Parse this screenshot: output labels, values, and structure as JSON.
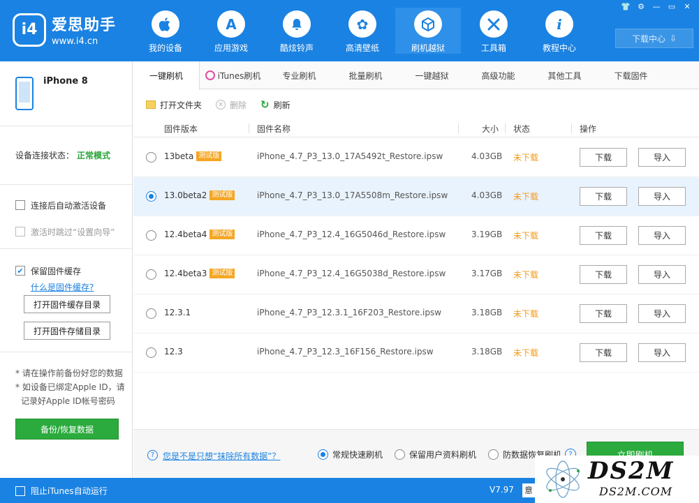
{
  "app": {
    "name": "爱思助手",
    "url": "www.i4.cn",
    "logo_mark": "i4"
  },
  "nav": [
    {
      "label": "我的设备",
      "icon": "apple-icon",
      "glyph": ""
    },
    {
      "label": "应用游戏",
      "icon": "app-store-icon",
      "glyph": "A"
    },
    {
      "label": "酷炫铃声",
      "icon": "bell-icon",
      "glyph": "🔔"
    },
    {
      "label": "高清壁纸",
      "icon": "flower-icon",
      "glyph": "✿"
    },
    {
      "label": "刷机越狱",
      "icon": "box-icon",
      "glyph": "⬡"
    },
    {
      "label": "工具箱",
      "icon": "tools-icon",
      "glyph": "✂"
    },
    {
      "label": "教程中心",
      "icon": "info-icon",
      "glyph": "i"
    }
  ],
  "window_controls": [
    "👕",
    "⚙",
    "—",
    "▭",
    "✕"
  ],
  "download_center": "下载中心",
  "left": {
    "device_name": "iPhone 8",
    "conn_label": "设备连接状态：",
    "conn_mode": "正常模式",
    "opt1": "连接后自动激活设备",
    "opt2": "激活时跳过“设置向导”",
    "cache_label": "保留固件缓存",
    "cache_link": "什么是固件缓存?",
    "btn_cache_dir": "打开固件缓存目录",
    "btn_store_dir": "打开固件存储目录",
    "note1": "* 请在操作前备份好您的数据",
    "note2": "* 如设备已绑定Apple ID，请",
    "note3": "记录好Apple ID帐号密码",
    "backup_btn": "备份/恢复数据"
  },
  "tabs": [
    "一键刷机",
    "iTunes刷机",
    "专业刷机",
    "批量刷机",
    "一键越狱",
    "高级功能",
    "其他工具",
    "下载固件"
  ],
  "toolbar": {
    "open_folder": "打开文件夹",
    "delete": "删除",
    "refresh": "刷新"
  },
  "table": {
    "headers": {
      "version": "固件版本",
      "name": "固件名称",
      "size": "大小",
      "status": "状态",
      "action": "操作"
    },
    "btn_download": "下载",
    "btn_import": "导入",
    "beta_badge": "测试版",
    "rows": [
      {
        "version": "13beta",
        "beta": true,
        "name": "iPhone_4.7_P3_13.0_17A5492t_Restore.ipsw",
        "size": "4.03GB",
        "status": "未下载",
        "selected": false
      },
      {
        "version": "13.0beta2",
        "beta": true,
        "name": "iPhone_4.7_P3_13.0_17A5508m_Restore.ipsw",
        "size": "4.03GB",
        "status": "未下载",
        "selected": true
      },
      {
        "version": "12.4beta4",
        "beta": true,
        "name": "iPhone_4.7_P3_12.4_16G5046d_Restore.ipsw",
        "size": "3.19GB",
        "status": "未下载",
        "selected": false
      },
      {
        "version": "12.4beta3",
        "beta": true,
        "name": "iPhone_4.7_P3_12.4_16G5038d_Restore.ipsw",
        "size": "3.17GB",
        "status": "未下载",
        "selected": false
      },
      {
        "version": "12.3.1",
        "beta": false,
        "name": "iPhone_4.7_P3_12.3.1_16F203_Restore.ipsw",
        "size": "3.18GB",
        "status": "未下载",
        "selected": false
      },
      {
        "version": "12.3",
        "beta": false,
        "name": "iPhone_4.7_P3_12.3_16F156_Restore.ipsw",
        "size": "3.18GB",
        "status": "未下载",
        "selected": false
      }
    ]
  },
  "footer": {
    "help_link": "您是不是只想“抹除所有数据”？",
    "mode1": "常规快速刷机",
    "mode2": "保留用户资料刷机",
    "mode3": "防数据恢复刷机",
    "flash_btn": "立即刷机"
  },
  "bottom": {
    "itunes_block": "阻止iTunes自动运行",
    "version": "V7.97",
    "extra": "意"
  },
  "watermark": {
    "text": "DS2M",
    "sub": "DS2M.COM"
  },
  "colors": {
    "brand_blue": "#1a82e2",
    "green": "#2bab3d",
    "status_orange": "#f29b1a",
    "beta_orange": "#f5a623"
  }
}
